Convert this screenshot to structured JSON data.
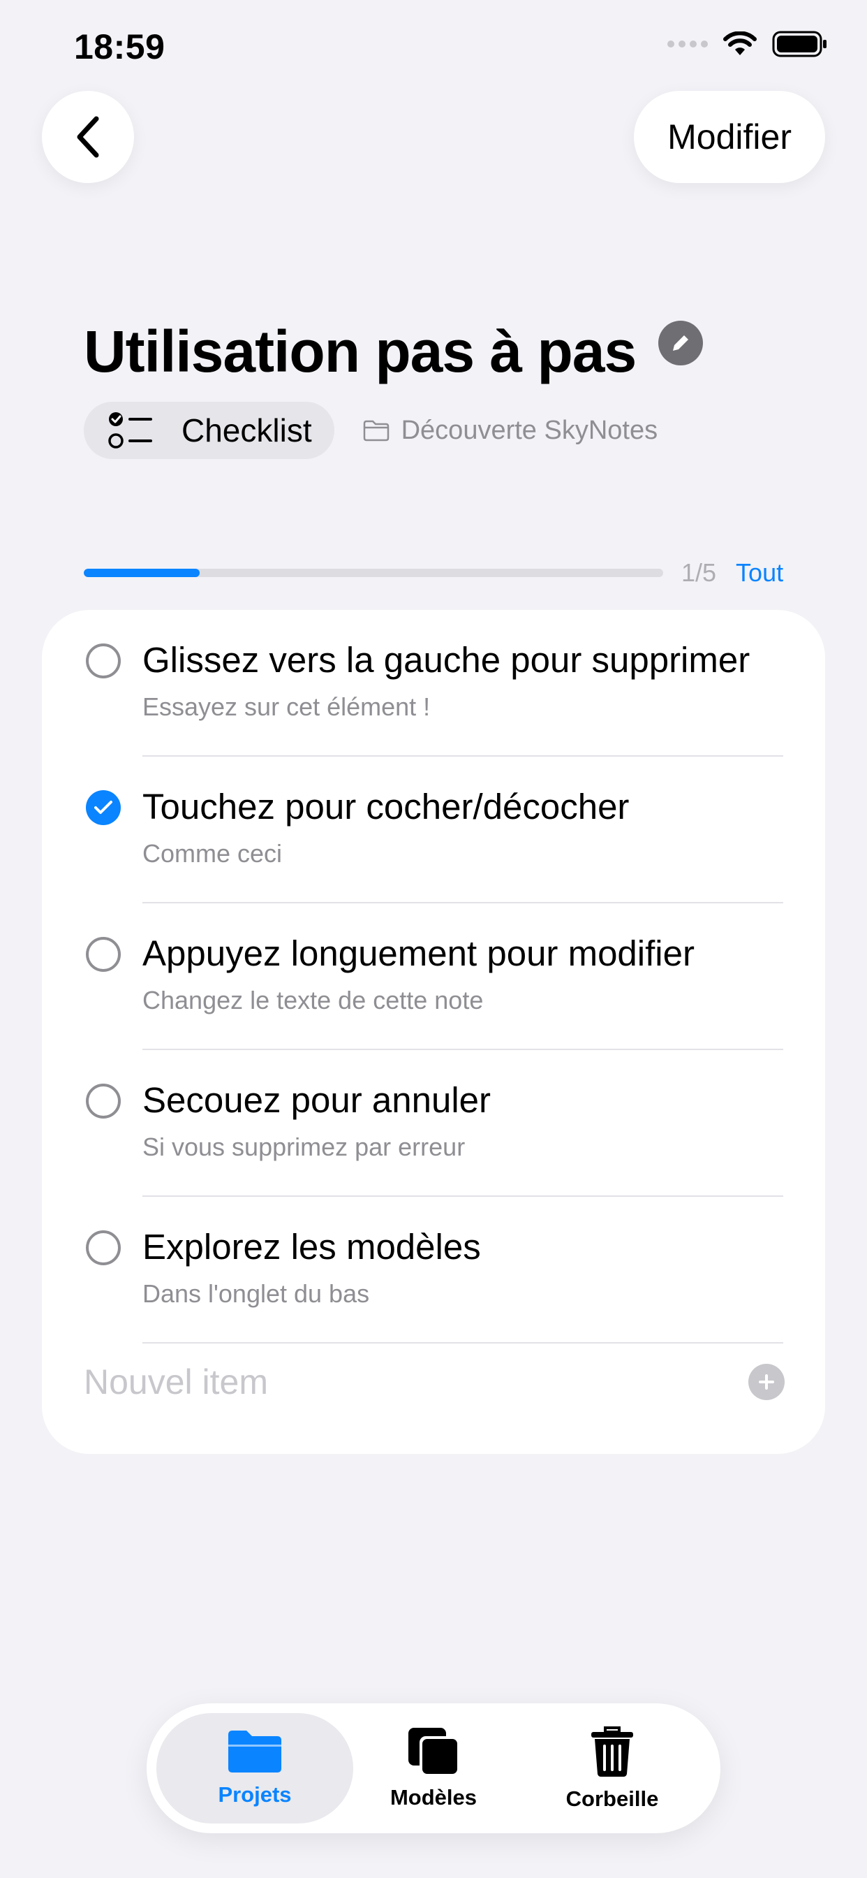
{
  "status_bar": {
    "time": "18:59"
  },
  "header": {
    "edit_label": "Modifier"
  },
  "note": {
    "title": "Utilisation pas à pas",
    "type_label": "Checklist",
    "folder": "Découverte SkyNotes"
  },
  "progress": {
    "count_text": "1/5",
    "fraction": 0.2,
    "all_label": "Tout"
  },
  "items": [
    {
      "title": "Glissez vers la gauche pour supprimer",
      "subtitle": "Essayez sur cet élément !",
      "checked": false
    },
    {
      "title": "Touchez pour cocher/décocher",
      "subtitle": "Comme ceci",
      "checked": true
    },
    {
      "title": "Appuyez longuement pour modifier",
      "subtitle": "Changez le texte de cette note",
      "checked": false
    },
    {
      "title": "Secouez pour annuler",
      "subtitle": "Si vous supprimez par erreur",
      "checked": false
    },
    {
      "title": "Explorez les modèles",
      "subtitle": "Dans l'onglet du bas",
      "checked": false
    }
  ],
  "new_item": {
    "placeholder": "Nouvel item"
  },
  "tabs": [
    {
      "label": "Projets",
      "icon": "folder-icon",
      "active": true
    },
    {
      "label": "Modèles",
      "icon": "stacked-squares-icon",
      "active": false
    },
    {
      "label": "Corbeille",
      "icon": "trash-icon",
      "active": false
    }
  ],
  "colors": {
    "accent": "#0a84ff",
    "background": "#f2f2f7",
    "secondary_text": "#8e8e93"
  }
}
